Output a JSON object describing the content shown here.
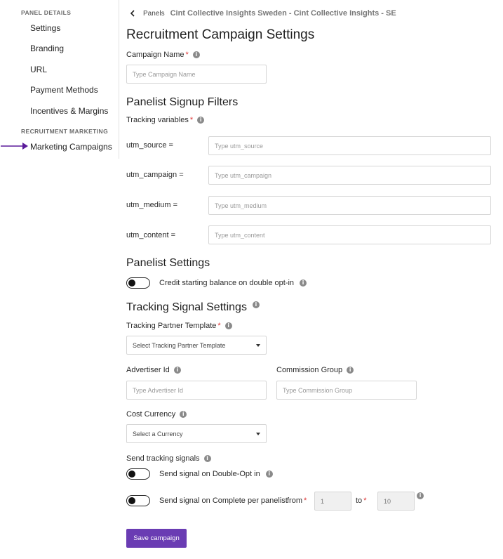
{
  "sidebar": {
    "panel_details_label": "PANEL DETAILS",
    "items": [
      {
        "label": "Settings"
      },
      {
        "label": "Branding"
      },
      {
        "label": "URL"
      },
      {
        "label": "Payment Methods"
      },
      {
        "label": "Incentives & Margins"
      }
    ],
    "recruitment_label": "RECRUITMENT MARKETING",
    "recruitment_items": [
      {
        "label": "Marketing Campaigns"
      }
    ],
    "arrow_color": "#5a1a9a"
  },
  "breadcrumb": {
    "panels": "Panels",
    "current": "Cint Collective Insights Sweden - Cint Collective Insights - SE"
  },
  "page_title": "Recruitment Campaign Settings",
  "campaign_name": {
    "label": "Campaign Name",
    "placeholder": "Type Campaign Name"
  },
  "signup_filters": {
    "title": "Panelist Signup Filters",
    "tracking_label": "Tracking variables",
    "utm": [
      {
        "label": "utm_source =",
        "placeholder": "Type utm_source"
      },
      {
        "label": "utm_campaign =",
        "placeholder": "Type utm_campaign"
      },
      {
        "label": "utm_medium =",
        "placeholder": "Type utm_medium"
      },
      {
        "label": "utm_content =",
        "placeholder": "Type utm_content"
      }
    ]
  },
  "panelist_settings": {
    "title": "Panelist Settings",
    "credit_toggle_label": "Credit starting balance on double opt-in"
  },
  "tracking_signal": {
    "title": "Tracking Signal Settings",
    "partner_template_label": "Tracking Partner Template",
    "partner_template_placeholder": "Select Tracking Partner Template",
    "advertiser_label": "Advertiser Id",
    "advertiser_placeholder": "Type Advertiser Id",
    "commission_label": "Commission Group",
    "commission_placeholder": "Type Commission Group",
    "currency_label": "Cost Currency",
    "currency_placeholder": "Select a Currency",
    "send_signals_label": "Send tracking signals",
    "double_optin_label": "Send signal on Double-Opt in",
    "complete_label": "Send signal on Complete per panelist",
    "from_label": "from",
    "from_value": "1",
    "to_label": "to",
    "to_value": "10"
  },
  "save_button": "Save campaign",
  "colors": {
    "accent": "#6a3cb3",
    "required": "#d33333"
  }
}
